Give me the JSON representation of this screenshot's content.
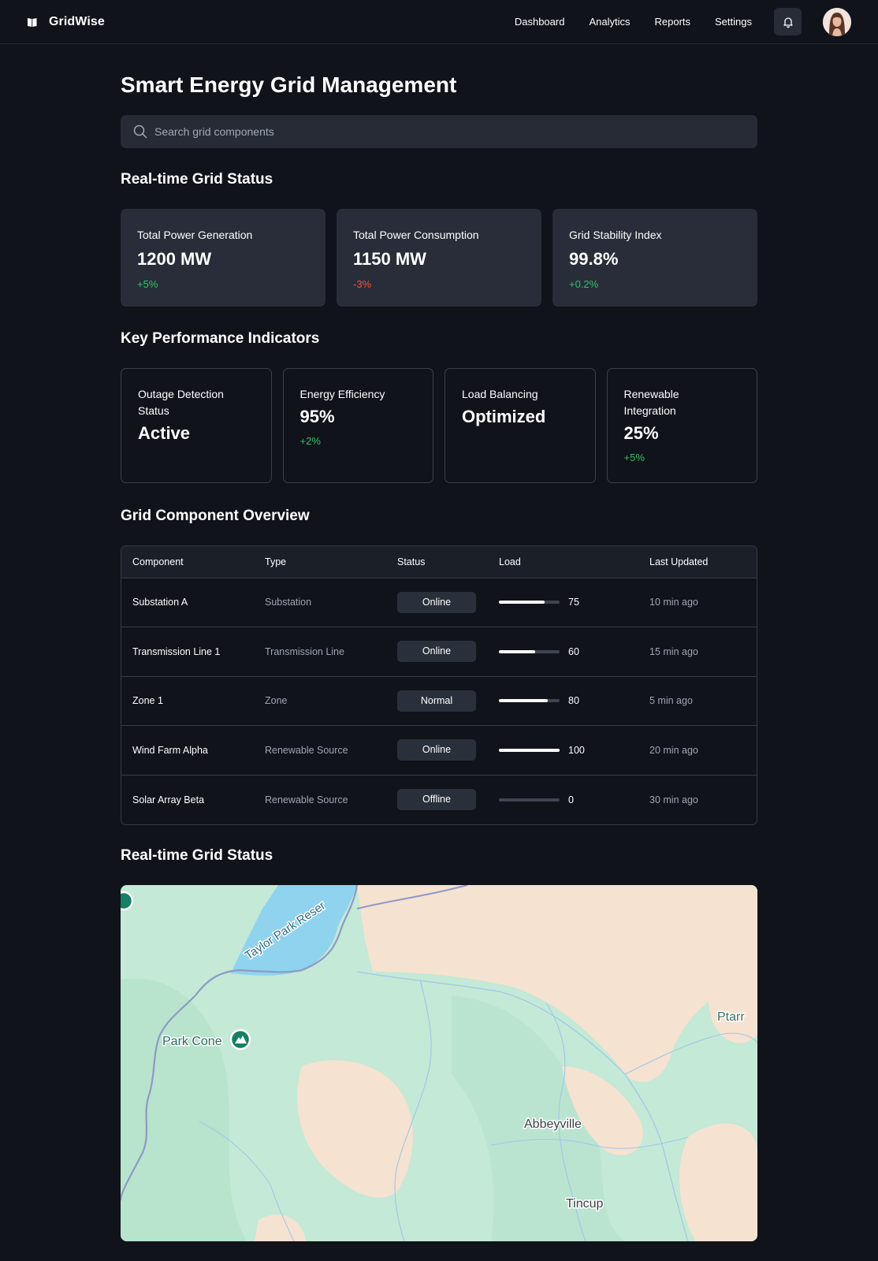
{
  "app": {
    "brand": "GridWise",
    "nav": [
      "Dashboard",
      "Analytics",
      "Reports",
      "Settings"
    ],
    "icons": {
      "brand": "book-icon",
      "notifications": "bell-icon",
      "search": "search-icon",
      "user": "user-avatar"
    }
  },
  "page": {
    "title": "Smart Energy Grid Management",
    "search_placeholder": "Search grid components"
  },
  "status": {
    "title": "Real-time Grid Status",
    "cards": [
      {
        "label": "Total Power Generation",
        "value": "1200 MW",
        "delta": "+5%",
        "trend": "up"
      },
      {
        "label": "Total Power Consumption",
        "value": "1150 MW",
        "delta": "-3%",
        "trend": "down"
      },
      {
        "label": "Grid Stability Index",
        "value": "99.8%",
        "delta": "+0.2%",
        "trend": "up"
      }
    ]
  },
  "kpis": {
    "title": "Key Performance Indicators",
    "items": [
      {
        "label": "Outage Detection Status",
        "value": "Active",
        "delta": ""
      },
      {
        "label": "Energy Efficiency",
        "value": "95%",
        "delta": "+2%"
      },
      {
        "label": "Load Balancing",
        "value": "Optimized",
        "delta": ""
      },
      {
        "label": "Renewable Integration",
        "value": "25%",
        "delta": "+5%"
      }
    ]
  },
  "components": {
    "title": "Grid Component Overview",
    "columns": [
      "Component",
      "Type",
      "Status",
      "Load",
      "Last Updated"
    ],
    "rows": [
      {
        "component": "Substation A",
        "type": "Substation",
        "status": "Online",
        "load": 75,
        "load_label": "75",
        "updated": "10 min ago"
      },
      {
        "component": "Transmission Line 1",
        "type": "Transmission Line",
        "status": "Online",
        "load": 60,
        "load_label": "60",
        "updated": "15 min ago"
      },
      {
        "component": "Zone 1",
        "type": "Zone",
        "status": "Normal",
        "load": 80,
        "load_label": "80",
        "updated": "5 min ago"
      },
      {
        "component": "Wind Farm Alpha",
        "type": "Renewable Source",
        "status": "Online",
        "load": 100,
        "load_label": "100",
        "updated": "20 min ago"
      },
      {
        "component": "Solar Array Beta",
        "type": "Renewable Source",
        "status": "Offline",
        "load": 0,
        "load_label": "0",
        "updated": "30 min ago"
      }
    ]
  },
  "map": {
    "title": "Real-time Grid Status",
    "labels": {
      "reservoir": "Taylor Park Reser",
      "peak": "Park Cone",
      "town1": "Abbeyville",
      "town2": "Tincup",
      "edge": "Ptarr"
    },
    "colors": {
      "forest": "#bfe8d3",
      "dark_forest": "#a9d9c0",
      "land": "#f6e1d0",
      "water": "#8fd3ee",
      "river": "#9ec7ea",
      "road": "#8d9ac5",
      "marker": "#178064"
    }
  }
}
